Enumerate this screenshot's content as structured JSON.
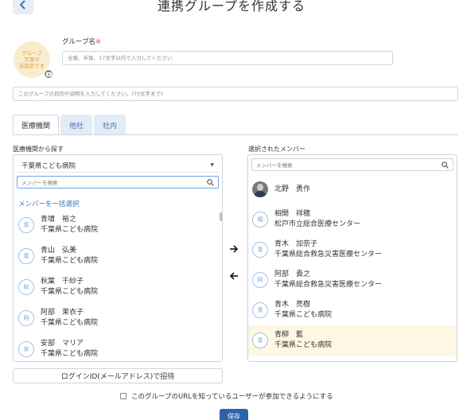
{
  "header": {
    "title": "連携グループを作成する",
    "back_icon": "chevron-left-icon"
  },
  "group_image": {
    "text": "グループ\n写真が\n未設定です",
    "camera_icon": "camera-icon"
  },
  "form": {
    "name_label": "グループ名",
    "required_mark": "※",
    "name_placeholder": "全角、半角、17文字以内で入力してください",
    "description_placeholder": "このグループの目的や説明を入力してください。(70文字まで)"
  },
  "tabs": [
    {
      "label": "医療機関",
      "active": true
    },
    {
      "label": "他社",
      "active": false
    },
    {
      "label": "社内",
      "active": false
    }
  ],
  "left_panel": {
    "label": "医療機関から探す",
    "selected_institution": "千葉県こども病院",
    "search_placeholder": "メンバーを検索",
    "select_all": "メンバーを一括選択",
    "members": [
      {
        "avatar": "青",
        "name": "青墳　裕之",
        "org": "千葉県こども病院"
      },
      {
        "avatar": "青",
        "name": "青山　弘美",
        "org": "千葉県こども病院"
      },
      {
        "avatar": "秋",
        "name": "秋葉　千紗子",
        "org": "千葉県こども病院"
      },
      {
        "avatar": "阿",
        "name": "阿部　茉衣子",
        "org": "千葉県こども病院"
      },
      {
        "avatar": "安",
        "name": "安部　マリア",
        "org": "千葉県こども病院"
      }
    ]
  },
  "right_panel": {
    "label": "選択されたメンバー",
    "search_placeholder": "メンバーを検索",
    "members": [
      {
        "avatar": "photo",
        "name": "北野　勇作",
        "org": "",
        "highlighted": false
      },
      {
        "avatar": "相",
        "name": "相関　祥穂",
        "org": "松戸市立総合医療センター",
        "highlighted": false
      },
      {
        "avatar": "青",
        "name": "青木　加奈子",
        "org": "千葉県総合救急災害医療センター",
        "highlighted": false
      },
      {
        "avatar": "阿",
        "name": "阿部　貴之",
        "org": "千葉県総合救急災害医療センター",
        "highlighted": false
      },
      {
        "avatar": "青",
        "name": "青木　亮樹",
        "org": "千葉県こども病院",
        "highlighted": false
      },
      {
        "avatar": "青",
        "name": "青柳　藍",
        "org": "千葉県こども病院",
        "highlighted": true
      }
    ]
  },
  "transfer": {
    "add_icon": "arrow-right-icon",
    "remove_icon": "arrow-left-icon"
  },
  "invite_button": "ログインID(メールアドレス)で招待",
  "url_join_label": "このグループのURLを知っているユーザーが参加できるようにする",
  "save_button": "保存",
  "colors": {
    "accent": "#3f74b4",
    "primary_button": "#2b64a8",
    "highlight": "#fdf7e3",
    "required": "#e05555"
  }
}
